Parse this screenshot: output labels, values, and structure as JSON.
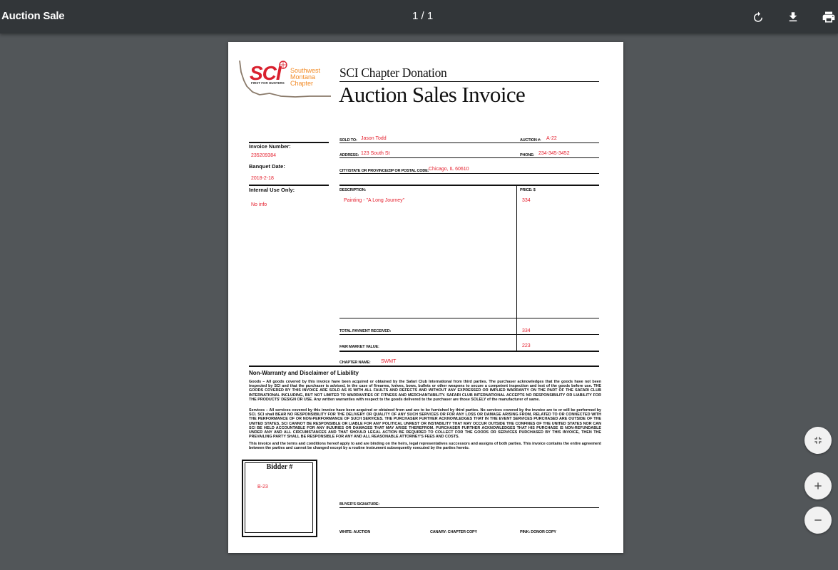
{
  "toolbar": {
    "title": "Auction Sale",
    "page_indicator": "1  /  1",
    "icons": [
      "rotate-icon",
      "download-icon",
      "print-icon"
    ]
  },
  "logo": {
    "brand": "SCI",
    "tagline": "FIRST FOR HUNTERS",
    "chapter_lines": [
      "Southwest",
      "Montana",
      "Chapter"
    ]
  },
  "header": {
    "subtitle": "SCI Chapter Donation",
    "title": "Auction Sales Invoice"
  },
  "fields": {
    "invoice_number_label": "Invoice Number:",
    "invoice_number": "235209384",
    "banquet_date_label": "Banquet Date:",
    "banquet_date": "2018-2-18",
    "internal_use_label": "Internal Use Only:",
    "internal_use": "No info",
    "sold_to_label": "SOLD TO:",
    "sold_to": "Jason Todd",
    "auction_no_label": "AUCTION #:",
    "auction_no": "A-22",
    "address_label": "ADDRESS:",
    "address": "123 South St",
    "phone_label": "PHONE:",
    "phone": "234-345-3452",
    "city_label": "CITY/STATE OR PROVINCE/ZIP OR POSTAL CODE:",
    "city": "Chicago, IL 60610",
    "description_label": "DESCRIPTION:",
    "description": "Painting - \"A Long Journey\"",
    "price_label": "PRICE: $",
    "price": "334",
    "total_payment_label": "TOTAL PAYMENT RECEIVED:",
    "total_payment": "334",
    "fair_market_label": "FAIR MARKET VALUE:",
    "fair_market": "223",
    "chapter_name_label": "CHAPTER NAME:",
    "chapter_name": "SWMT",
    "bidder_label": "Bidder #",
    "bidder": "B-23",
    "buyer_signature_label": "BUYER'S SIGNATURE:"
  },
  "disclaimer": {
    "heading": "Non-Warranty and Disclaimer of Liability",
    "goods": "Goods – All goods covered by this invoice have been acquired or obtained by the Safari Club International from third parties. The purchaser acknowledges that the goods have not been inspected by SCI and that the purchaser is advised, in the case of firearms, knives, bows, bullets or other weapons to secure a competent inspection and test of the goods before use. THE GOODS COVERED BY THIS INVOICE ARE SOLD AS IS WITH ALL FAULTS AND DEFECTS AND WITHOUT ANY EXPRESSED OR IMPLIED WARRANTY ON THE PART OF THE SAFARI CLUB INTERNATIONAL INCLUDING, BUT NOT LIMITED TO WARRANTIES OF FITNESS AND MERCHANTABILITY. SAFARI CLUB INTERNATIONAL ACCEPTS NO RESPONSIBILITY OR LIABILITY FOR THE PRODUCTS' DESIGN OR USE. Any written warranties with respect to the goods delivered to the purchaser are those SOLELY of the manufacturer of same.",
    "services": "Services – All services covered by this invoice have been acquired or obtained from and are to be furnished by third parties. No services covered by the invoice are to or will be performed by SCI. SCI shall BEAR NO RESPONSIBILITY FOR THE DELIVERY OR QUALITY OF ANY SUCH SERVICES OR FOR ANY LOSS OR DAMAGE ARISING FROM, RELATED TO OR CONNECTED WITH THE PERFORMANCE OF OR NON-PERFORMANCE OF SUCH SERVICES. THE PURCHASER FURTHER ACKNOWLEDGES THAT IN THE EVENT SERVICES PURCHASED ARE OUTSIDE OF THE UNITED STATES, SCI CANNOT BE RESPONSIBLE OR LIABLE FOR ANY POLITICAL UNREST OR INSTABILITY THAT MAY OCCUR OUTSIDE THE CONFINES OF THE UNITED STATES NOR CAN SCI BE HELD ACCOUNTABLE FOR ANY INJURIES OR DAMAGES THAT MAY ARISE THEREFROM. PURCHASER FURTHER ACKNOWLEDGES THAT HIS PURCHASE IS NON-REFUNDABLE UNDER ANY AND ALL CIRCUMSTANCES AND THAT SHOULD LEGAL ACTION BE REQUIRED TO COLLECT FOR THE GOODS OR SERVICES PURCHASED BY THIS INVOICE, THEN THE PREVAILING PARTY SHALL BE RESPONSIBLE FOR ANY AND ALL REASONABLE ATTORNEY'S FEES AND COSTS.",
    "binding": "This invoice and the terms and conditions hereof apply to and are binding on the heirs, legal representatives successors and assigns of both parties. This invoice contains the entire agreement between the parties and cannot be changed except by a routine instrument subsequently executed by the parties hereto."
  },
  "copies": {
    "white": "WHITE: AUCTION",
    "canary": "CANARY: CHAPTER COPY",
    "pink": "PINK: DONOR COPY"
  },
  "zoom": {
    "fit_icon": "fit-to-page-icon",
    "zoom_in_icon": "plus-icon",
    "zoom_out_icon": "minus-icon"
  },
  "colors": {
    "toolbar": "#323639",
    "viewer_bg": "#525659",
    "handwritten": "#e41e2c",
    "sci_red": "#d9202e",
    "chapter_orange": "#f28c28"
  }
}
